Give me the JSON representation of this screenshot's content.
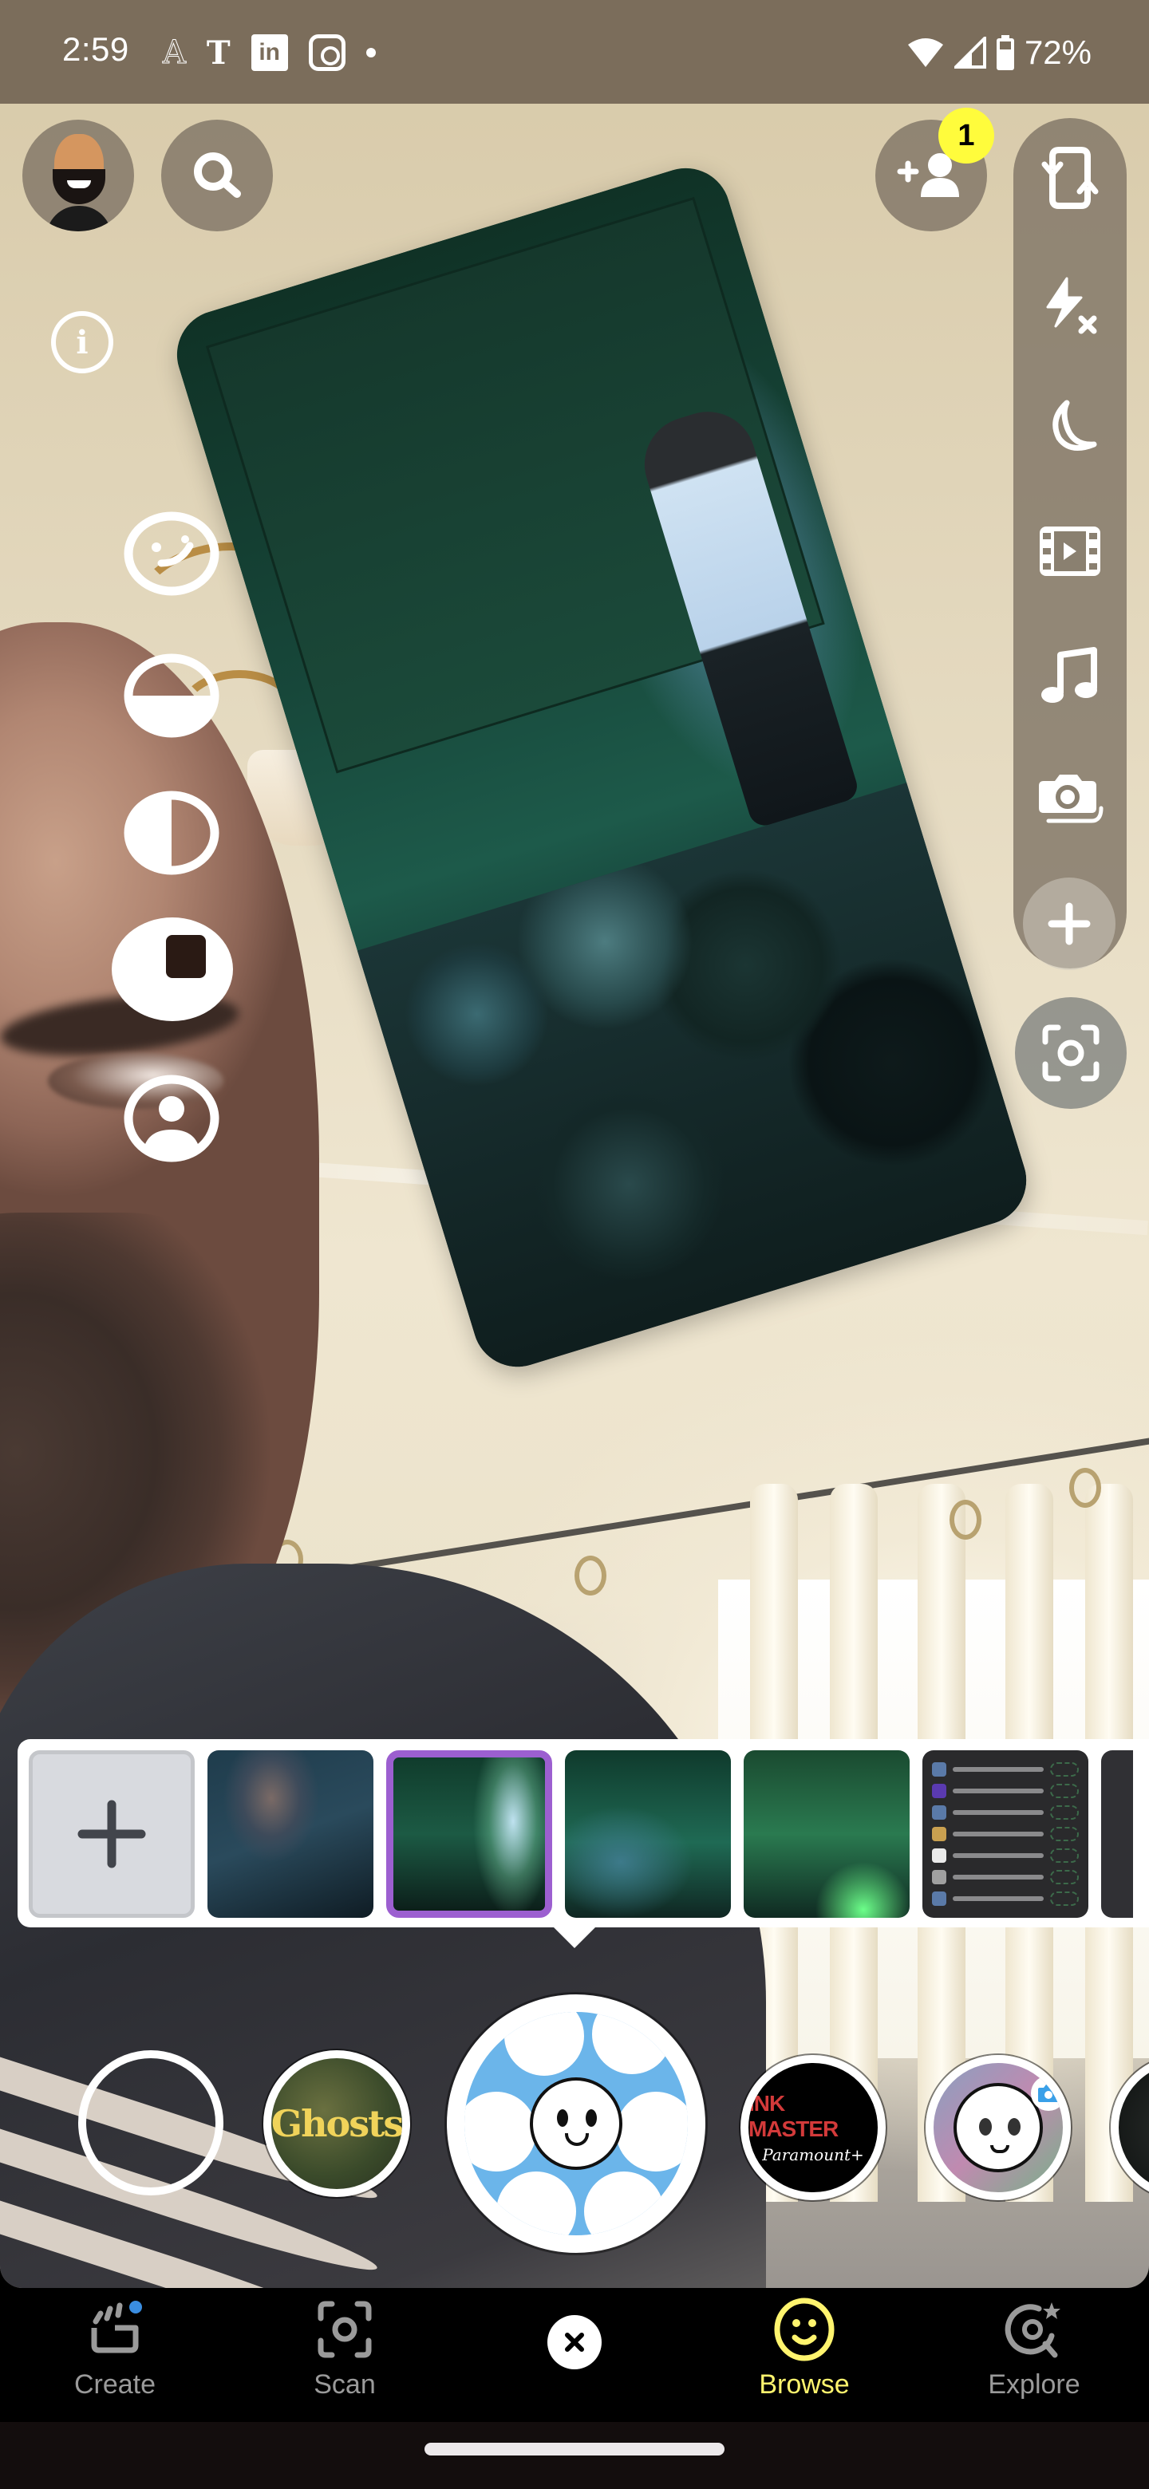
{
  "status_bar": {
    "time": "2:59",
    "notification_icons": [
      "font-a-icon",
      "nyt-icon",
      "linkedin-icon",
      "instagram-icon",
      "more-dot-icon"
    ],
    "linkedin_text": "in",
    "font_a_text": "A",
    "nyt_text": "T",
    "battery_percent": "72%",
    "system_icons": [
      "wifi-icon",
      "cell-signal-icon",
      "battery-icon"
    ]
  },
  "top_controls": {
    "profile": "bitmoji-avatar",
    "search": "search-icon",
    "info": "i",
    "add_friend": "add-friend-icon",
    "add_friend_badge": "1"
  },
  "right_toolbar": {
    "items": [
      {
        "name": "flip-camera",
        "icon": "flip-camera-icon"
      },
      {
        "name": "flash-off",
        "icon": "flash-off-icon"
      },
      {
        "name": "night-mode",
        "icon": "moon-icon"
      },
      {
        "name": "video-mode",
        "icon": "film-icon"
      },
      {
        "name": "sound",
        "icon": "music-note-icon"
      },
      {
        "name": "multi-snap",
        "icon": "multi-camera-icon"
      }
    ],
    "more": "plus-icon",
    "scan": "scan-icon"
  },
  "left_modes": [
    {
      "name": "face-lens",
      "icon": "face-icon"
    },
    {
      "name": "split-horizontal",
      "icon": "half-bottom-icon"
    },
    {
      "name": "split-vertical",
      "icon": "half-left-icon"
    },
    {
      "name": "frame-mode",
      "icon": "square-in-circle-icon",
      "selected": true
    },
    {
      "name": "portrait",
      "icon": "person-icon"
    }
  ],
  "media_tray": {
    "add_label": "+",
    "thumbnails": [
      {
        "name": "concert-crowd-photo",
        "selected": false
      },
      {
        "name": "concert-stage-photo",
        "selected": true
      },
      {
        "name": "concert-crowd-photo-2",
        "selected": false
      },
      {
        "name": "concert-stage-photo-2",
        "selected": false
      },
      {
        "name": "app-list-screenshot",
        "selected": false
      },
      {
        "name": "partial-screenshot",
        "selected": false
      }
    ],
    "selected_color": "#9c5fd0"
  },
  "lens_carousel": {
    "items": [
      {
        "name": "no-lens"
      },
      {
        "name": "ghosts-lens",
        "label": "Ghosts"
      },
      {
        "name": "selected-lens",
        "selected": true
      },
      {
        "name": "ink-master-lens",
        "label": "INK MASTER",
        "sublabel": "Paramount+"
      },
      {
        "name": "anime-face-lens"
      },
      {
        "name": "partial-lens"
      }
    ]
  },
  "bottom_nav": {
    "items": [
      {
        "label": "Create",
        "icon": "create-icon",
        "active": false,
        "has_dot": true
      },
      {
        "label": "Scan",
        "icon": "scan-icon",
        "active": false
      },
      {
        "label": "Browse",
        "icon": "smiley-icon",
        "active": true
      },
      {
        "label": "Explore",
        "icon": "explore-icon",
        "active": false
      }
    ],
    "close": "close-icon",
    "active_color": "#fff46e",
    "dot_color": "#3a8de0"
  }
}
